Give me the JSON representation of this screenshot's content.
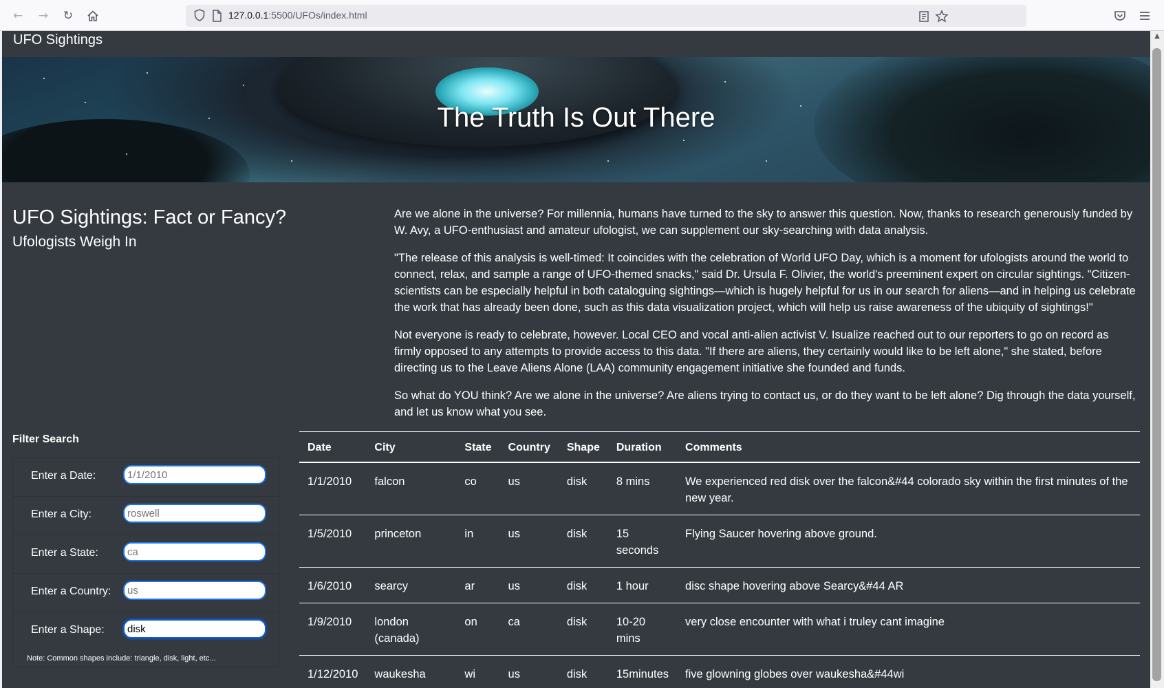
{
  "browser": {
    "url_host": "127.0.0.1",
    "url_rest": ":5500/UFOs/index.html"
  },
  "navbar": {
    "brand": "UFO Sightings"
  },
  "hero": {
    "title": "The Truth Is Out There"
  },
  "main": {
    "heading": "UFO Sightings: Fact or Fancy?",
    "subheading": "Ufologists Weigh In",
    "paragraphs": [
      "Are we alone in the universe? For millennia, humans have turned to the sky to answer this question. Now, thanks to research generously funded by W. Avy, a UFO-enthusiast and amateur ufologist, we can supplement our sky-searching with data analysis.",
      "\"The release of this analysis is well-timed: It coincides with the celebration of World UFO Day, which is a moment for ufologists around the world to connect, relax, and sample a range of UFO-themed snacks,\" said Dr. Ursula F. Olivier, the world's preeminent expert on circular sightings. \"Citizen-scientists can be especially helpful in both cataloguing sightings—which is hugely helpful for us in our search for aliens—and in helping us celebrate the work that has already been done, such as this data visualization project, which will help us raise awareness of the ubiquity of sightings!\"",
      "Not everyone is ready to celebrate, however. Local CEO and vocal anti-alien activist V. Isualize reached out to our reporters to go on record as firmly opposed to any attempts to provide access to this data. \"If there are aliens, they certainly would like to be left alone,\" she stated, before directing us to the Leave Aliens Alone (LAA) community engagement initiative she founded and funds.",
      "So what do YOU think? Are we alone in the universe? Are aliens trying to contact us, or do they want to be left alone? Dig through the data yourself, and let us know what you see."
    ]
  },
  "filter": {
    "title": "Filter Search",
    "fields": [
      {
        "label": "Enter a Date:",
        "placeholder": "1/1/2010",
        "value": ""
      },
      {
        "label": "Enter a City:",
        "placeholder": "roswell",
        "value": ""
      },
      {
        "label": "Enter a State:",
        "placeholder": "ca",
        "value": ""
      },
      {
        "label": "Enter a Country:",
        "placeholder": "us",
        "value": ""
      },
      {
        "label": "Enter a Shape:",
        "placeholder": "",
        "value": "disk"
      }
    ],
    "note": "Note: Common shapes include: triangle, disk, light, etc..."
  },
  "table": {
    "headers": [
      "Date",
      "City",
      "State",
      "Country",
      "Shape",
      "Duration",
      "Comments"
    ],
    "rows": [
      [
        "1/1/2010",
        "falcon",
        "co",
        "us",
        "disk",
        "8 mins",
        "We experienced red disk over the falcon&#44 colorado sky within the first minutes of the new year."
      ],
      [
        "1/5/2010",
        "princeton",
        "in",
        "us",
        "disk",
        "15 seconds",
        "Flying Saucer hovering above ground."
      ],
      [
        "1/6/2010",
        "searcy",
        "ar",
        "us",
        "disk",
        "1 hour",
        "disc shape hovering above Searcy&#44 AR"
      ],
      [
        "1/9/2010",
        "london (canada)",
        "on",
        "ca",
        "disk",
        "10-20 mins",
        "very close encounter with what i truley cant imagine"
      ],
      [
        "1/12/2010",
        "waukesha",
        "wi",
        "us",
        "disk",
        "15minutes",
        "five glowning globes over waukesha&#44wi"
      ]
    ]
  },
  "colors": {
    "page_bg": "#343a40",
    "input_border": "#1a73e8",
    "text": "#ffffff"
  }
}
